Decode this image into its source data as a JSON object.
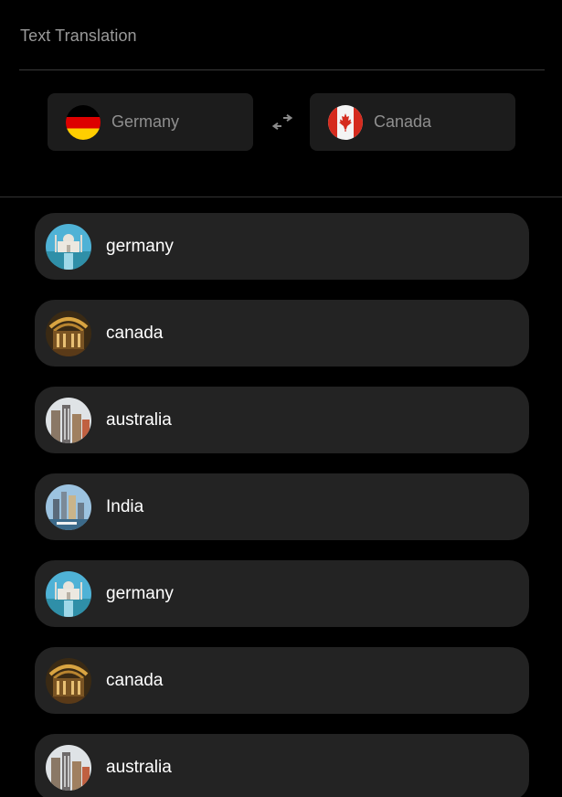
{
  "header": {
    "title": "Text Translation"
  },
  "source_language": {
    "name": "Germany",
    "flag": "germany-flag-icon"
  },
  "target_language": {
    "name": "Canada",
    "flag": "canada-flag-icon"
  },
  "swap": {
    "icon": "swap-arrows-icon"
  },
  "items": [
    {
      "label": "germany",
      "thumbnail": "palace-reflecting-pool"
    },
    {
      "label": "canada",
      "thumbnail": "ornate-golden-hall"
    },
    {
      "label": "australia",
      "thumbnail": "city-towers"
    },
    {
      "label": "India",
      "thumbnail": "city-skyline-waterfront"
    },
    {
      "label": "germany",
      "thumbnail": "palace-reflecting-pool"
    },
    {
      "label": "canada",
      "thumbnail": "ornate-golden-hall"
    },
    {
      "label": "australia",
      "thumbnail": "city-towers"
    }
  ],
  "colors": {
    "background": "#000000",
    "card": "#232323",
    "selector": "#1c1c1c",
    "muted_text": "#9a9a9a",
    "text": "#ffffff"
  }
}
